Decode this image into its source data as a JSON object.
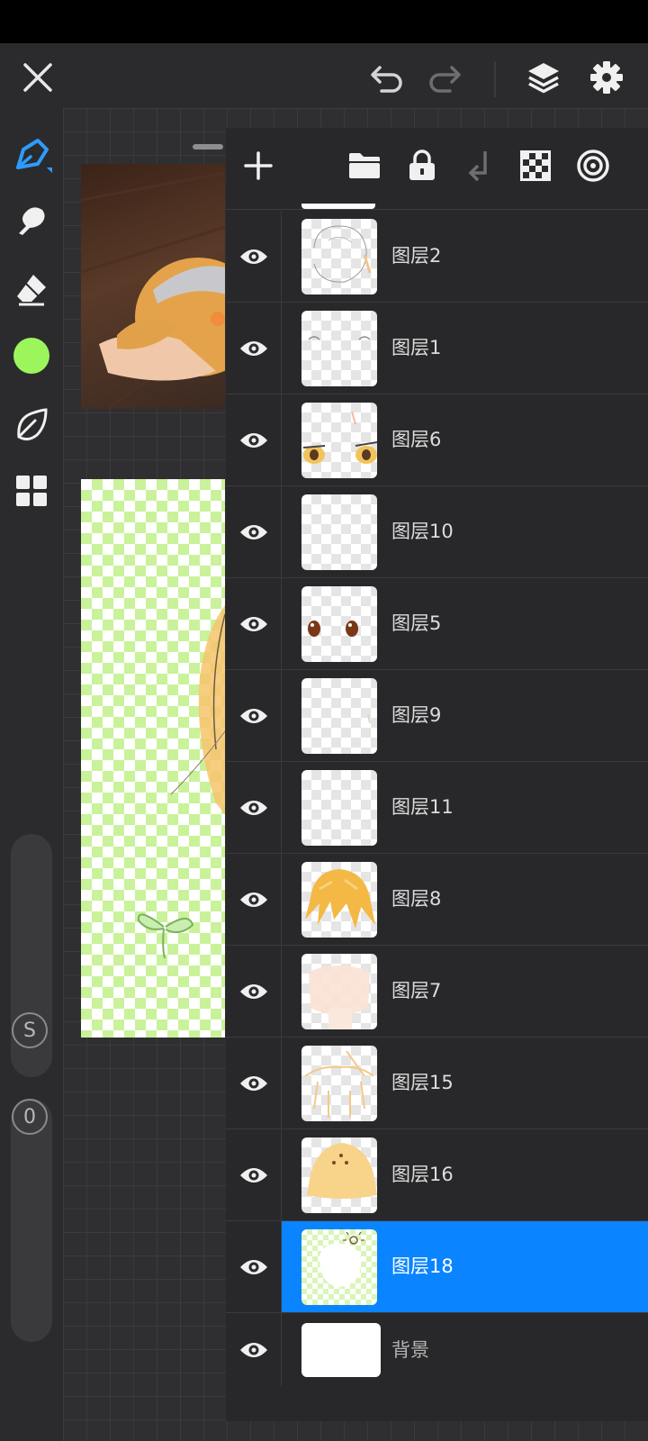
{
  "colors": {
    "accent": "#0a84ff",
    "brush_color": "#9cf55a",
    "background": "#2b2b2d"
  },
  "top_bar": {
    "icons": [
      "close-icon",
      "undo-icon",
      "redo-icon",
      "layers-icon",
      "settings-icon"
    ]
  },
  "left_toolbar": {
    "tools": [
      "brush-tool-icon",
      "smudge-tool-icon",
      "eraser-tool-icon",
      "color-swatch",
      "leaf-stabilizer-icon",
      "grid-menu-icon"
    ],
    "size_slider_label": "S",
    "opacity_slider_label": "0"
  },
  "layers_panel": {
    "toolbar_icons": [
      "add-layer-icon",
      "folder-icon",
      "lock-icon",
      "merge-down-icon",
      "transparency-icon",
      "blend-mode-icon"
    ],
    "layers": [
      {
        "name": "图层2",
        "visible": true,
        "selected": false
      },
      {
        "name": "图层1",
        "visible": true,
        "selected": false
      },
      {
        "name": "图层6",
        "visible": true,
        "selected": false
      },
      {
        "name": "图层10",
        "visible": true,
        "selected": false
      },
      {
        "name": "图层5",
        "visible": true,
        "selected": false
      },
      {
        "name": "图层9",
        "visible": true,
        "selected": false
      },
      {
        "name": "图层11",
        "visible": true,
        "selected": false
      },
      {
        "name": "图层8",
        "visible": true,
        "selected": false
      },
      {
        "name": "图层7",
        "visible": true,
        "selected": false
      },
      {
        "name": "图层15",
        "visible": true,
        "selected": false
      },
      {
        "name": "图层16",
        "visible": true,
        "selected": false
      },
      {
        "name": "图层18",
        "visible": true,
        "selected": true
      },
      {
        "name": "背景",
        "visible": true,
        "selected": false
      }
    ]
  }
}
